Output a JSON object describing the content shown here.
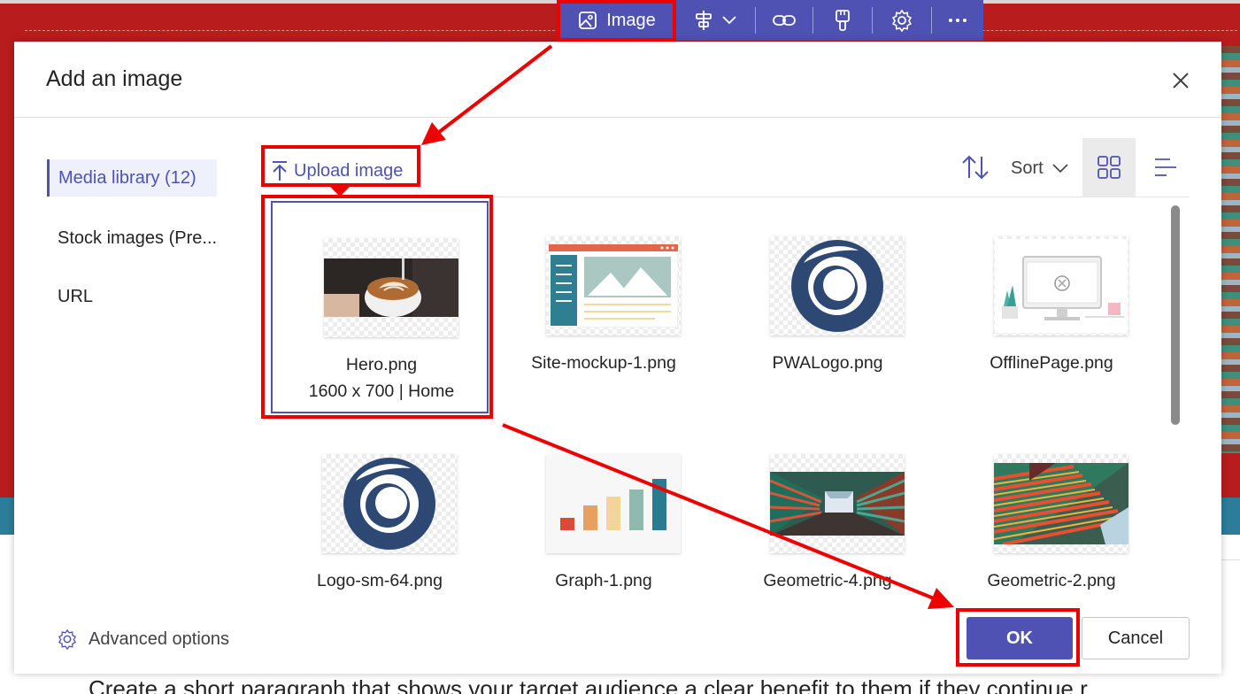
{
  "toolbar": {
    "image_label": "Image",
    "icons": [
      "image-icon",
      "align-icon",
      "chevron-down-icon",
      "link-icon",
      "format-painter-icon",
      "gear-icon",
      "more-icon"
    ]
  },
  "dialog": {
    "title": "Add an image"
  },
  "nav": {
    "items": [
      {
        "label": "Media library (12)",
        "selected": true
      },
      {
        "label": "Stock images (Pre..."
      },
      {
        "label": "URL"
      }
    ]
  },
  "commands": {
    "upload_label": "Upload image",
    "sort_label": "Sort"
  },
  "grid": {
    "items": [
      {
        "name": "Hero.png",
        "meta": "1600 x 700 | Home",
        "selected": true
      },
      {
        "name": "Site-mockup-1.png"
      },
      {
        "name": "PWALogo.png"
      },
      {
        "name": "OfflinePage.png"
      },
      {
        "name": "Logo-sm-64.png"
      },
      {
        "name": "Graph-1.png"
      },
      {
        "name": "Geometric-4.png"
      },
      {
        "name": "Geometric-2.png"
      }
    ]
  },
  "footer": {
    "advanced_label": "Advanced options",
    "ok_label": "OK",
    "cancel_label": "Cancel"
  },
  "background": {
    "paragraph": "Create a short paragraph that shows your target audience a clear benefit to them if they continue r"
  },
  "colors": {
    "accent": "#4f52b2",
    "banner": "#b91c1c",
    "annotation": "#ee0000"
  }
}
